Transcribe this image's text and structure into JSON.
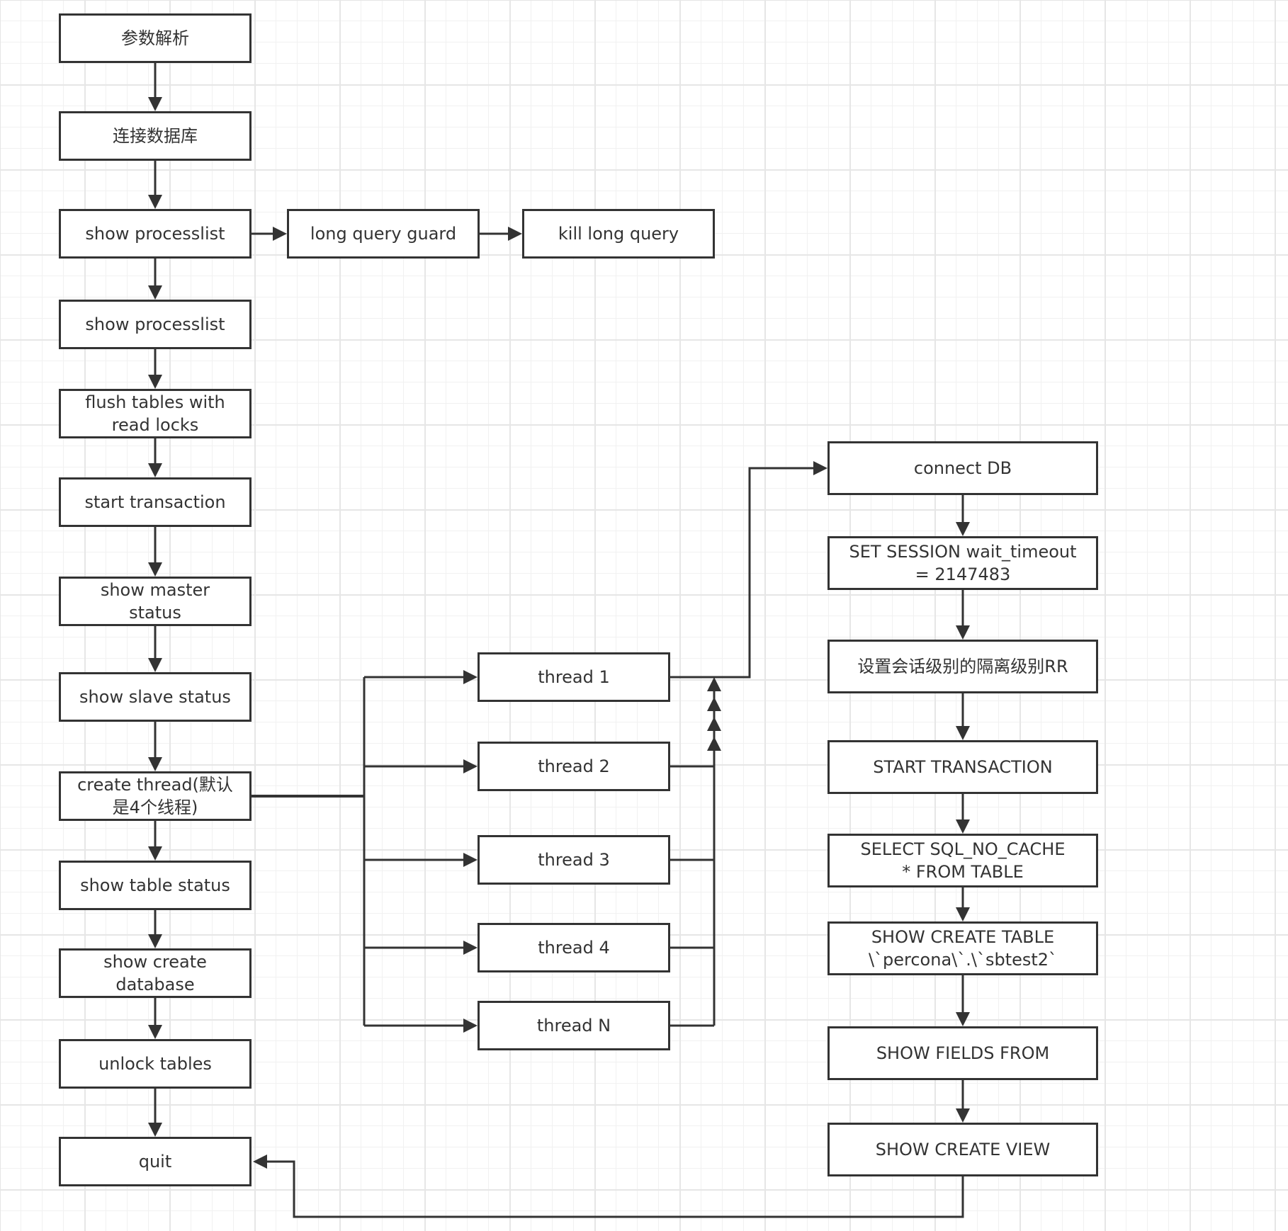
{
  "diagram": {
    "type": "flowchart",
    "colors": {
      "stroke": "#333333",
      "fill": "#ffffff",
      "text": "#333333",
      "grid": "#f1f1f1",
      "grid_major": "#e6e6e6"
    },
    "nodes": {
      "param_parse": "参数解析",
      "connect_database": "连接数据库",
      "show_processlist_1": "show processlist",
      "long_query_guard": "long query guard",
      "kill_long_query": "kill long query",
      "show_processlist_2": "show processlist",
      "flush_tables": "flush tables with\nread locks",
      "start_transaction": "start transaction",
      "show_master_status": "show master\nstatus",
      "show_slave_status": "show slave status",
      "create_thread": "create thread(默认\n是4个线程)",
      "show_table_status": "show table status",
      "show_create_database": "show create\ndatabase",
      "unlock_tables": "unlock tables",
      "quit": "quit",
      "thread_1": "thread 1",
      "thread_2": "thread 2",
      "thread_3": "thread 3",
      "thread_4": "thread 4",
      "thread_n": "thread N",
      "connect_db": "connect DB",
      "set_session_wait_timeout": "SET SESSION wait_timeout\n= 2147483",
      "set_isolation_rr": "设置会话级别的隔离级别RR",
      "start_transaction_upper": "START TRANSACTION",
      "select_sql_no_cache": "SELECT SQL_NO_CACHE\n* FROM TABLE",
      "show_create_table": "SHOW CREATE TABLE\n\\`percona\\`.\\`sbtest2`",
      "show_fields_from": "SHOW FIELDS FROM",
      "show_create_view": "SHOW CREATE VIEW"
    },
    "edges": [
      [
        "param_parse",
        "connect_database"
      ],
      [
        "connect_database",
        "show_processlist_1"
      ],
      [
        "show_processlist_1",
        "long_query_guard"
      ],
      [
        "long_query_guard",
        "kill_long_query"
      ],
      [
        "show_processlist_1",
        "show_processlist_2"
      ],
      [
        "show_processlist_2",
        "flush_tables"
      ],
      [
        "flush_tables",
        "start_transaction"
      ],
      [
        "start_transaction",
        "show_master_status"
      ],
      [
        "show_master_status",
        "show_slave_status"
      ],
      [
        "show_slave_status",
        "create_thread"
      ],
      [
        "create_thread",
        "show_table_status"
      ],
      [
        "show_table_status",
        "show_create_database"
      ],
      [
        "show_create_database",
        "unlock_tables"
      ],
      [
        "unlock_tables",
        "quit"
      ],
      [
        "create_thread",
        "thread_1"
      ],
      [
        "create_thread",
        "thread_2"
      ],
      [
        "create_thread",
        "thread_3"
      ],
      [
        "create_thread",
        "thread_4"
      ],
      [
        "create_thread",
        "thread_n"
      ],
      [
        "thread_1",
        "connect_db"
      ],
      [
        "thread_2",
        "connect_db"
      ],
      [
        "thread_3",
        "connect_db"
      ],
      [
        "thread_4",
        "connect_db"
      ],
      [
        "thread_n",
        "connect_db"
      ],
      [
        "connect_db",
        "set_session_wait_timeout"
      ],
      [
        "set_session_wait_timeout",
        "set_isolation_rr"
      ],
      [
        "set_isolation_rr",
        "start_transaction_upper"
      ],
      [
        "start_transaction_upper",
        "select_sql_no_cache"
      ],
      [
        "select_sql_no_cache",
        "show_create_table"
      ],
      [
        "show_create_table",
        "show_fields_from"
      ],
      [
        "show_fields_from",
        "show_create_view"
      ],
      [
        "show_create_view",
        "quit"
      ]
    ]
  }
}
